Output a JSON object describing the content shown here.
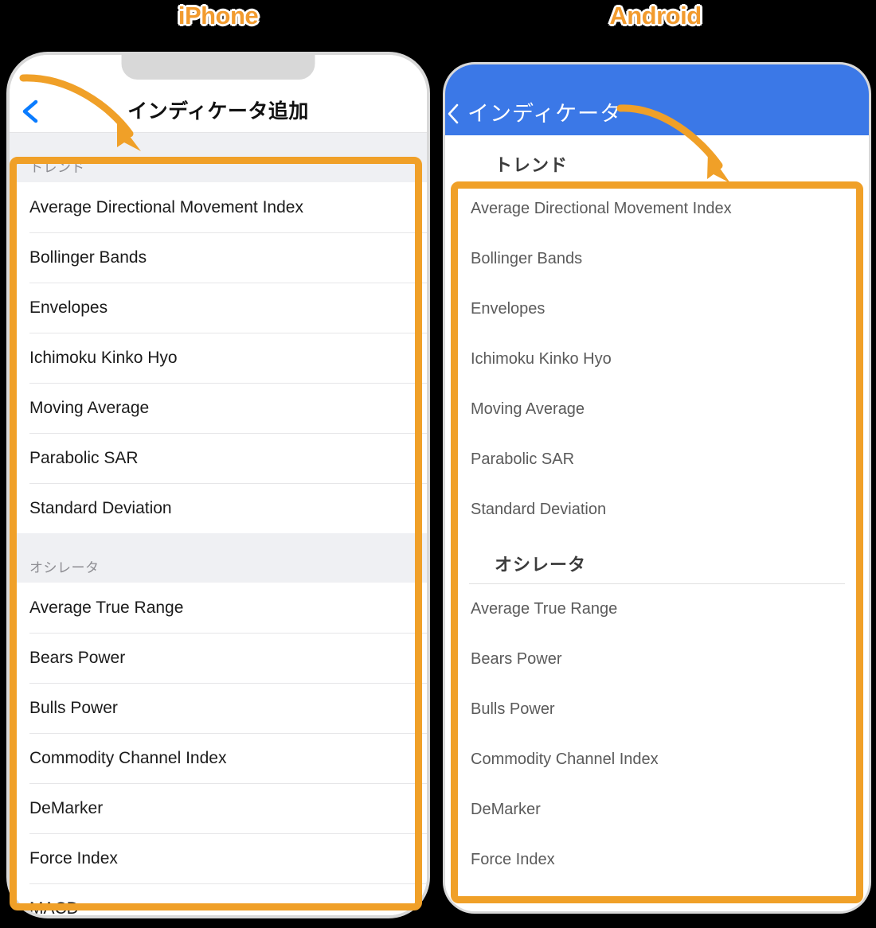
{
  "captions": {
    "iphone": "iPhone",
    "android": "Android",
    "color": "#f29b2e"
  },
  "annotations": {
    "highlight_color": "#f0a028",
    "arrow_color": "#f0a028",
    "iphone_arrow": "curved-arrow-pointing-to-indicator-list",
    "android_arrow": "curved-arrow-pointing-to-indicator-list"
  },
  "iphone": {
    "navbar": {
      "title": "インディケータ追加",
      "back_icon": "chevron-left-icon",
      "back_color": "#0a7cff",
      "background": "#ffffff"
    },
    "sections": [
      {
        "header": "トレンド",
        "items": [
          "Average Directional Movement Index",
          "Bollinger Bands",
          "Envelopes",
          "Ichimoku Kinko Hyo",
          "Moving Average",
          "Parabolic SAR",
          "Standard Deviation"
        ]
      },
      {
        "header": "オシレータ",
        "items": [
          "Average True Range",
          "Bears Power",
          "Bulls Power",
          "Commodity Channel Index",
          "DeMarker",
          "Force Index",
          "MACD"
        ]
      }
    ]
  },
  "android": {
    "appbar": {
      "title": "インディケータ",
      "back_icon": "chevron-left-icon",
      "background": "#3b78e7",
      "text_color": "#ffffff"
    },
    "sections": [
      {
        "header": "トレンド",
        "items": [
          "Average Directional Movement Index",
          "Bollinger Bands",
          "Envelopes",
          "Ichimoku Kinko Hyo",
          "Moving Average",
          "Parabolic SAR",
          "Standard Deviation"
        ]
      },
      {
        "header": "オシレータ",
        "items": [
          "Average True Range",
          "Bears Power",
          "Bulls Power",
          "Commodity Channel Index",
          "DeMarker",
          "Force Index"
        ]
      }
    ]
  }
}
